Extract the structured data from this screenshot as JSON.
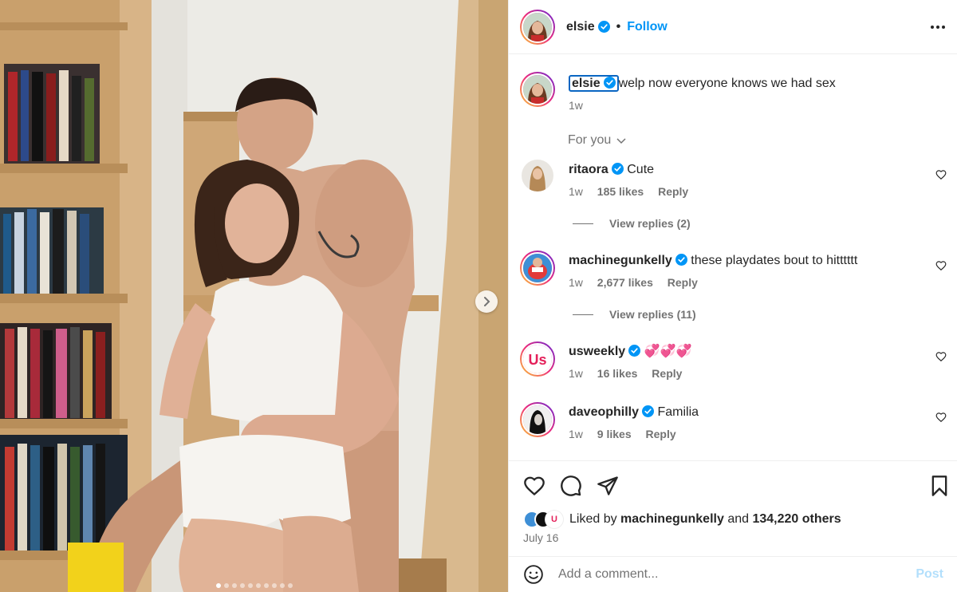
{
  "post": {
    "username": "elsie",
    "separator": "•",
    "follow_label": "Follow",
    "caption": "welp now everyone knows we had sex",
    "caption_time": "1w",
    "sort_label": "For you",
    "photo_dots": 10,
    "active_dot": 0,
    "accent_color": "#0095f6"
  },
  "comments": [
    {
      "username": "ritaora",
      "text": "Cute",
      "time": "1w",
      "likes": "185 likes",
      "reply": "Reply",
      "view_replies": "View replies (2)"
    },
    {
      "username": "machinegunkelly",
      "text": "these playdates bout to hitttttt",
      "time": "1w",
      "likes": "2,677 likes",
      "reply": "Reply",
      "view_replies": "View replies (11)"
    },
    {
      "username": "usweekly",
      "text": "💞💞💞",
      "time": "1w",
      "likes": "16 likes",
      "reply": "Reply"
    },
    {
      "username": "daveophilly",
      "text": "Familia",
      "time": "1w",
      "likes": "9 likes",
      "reply": "Reply"
    }
  ],
  "footer": {
    "liked_prefix": "Liked by",
    "liked_user": "machinegunkelly",
    "liked_and": "and",
    "liked_others": "134,220 others",
    "date": "July 16",
    "comment_placeholder": "Add a comment...",
    "post_label": "Post"
  }
}
